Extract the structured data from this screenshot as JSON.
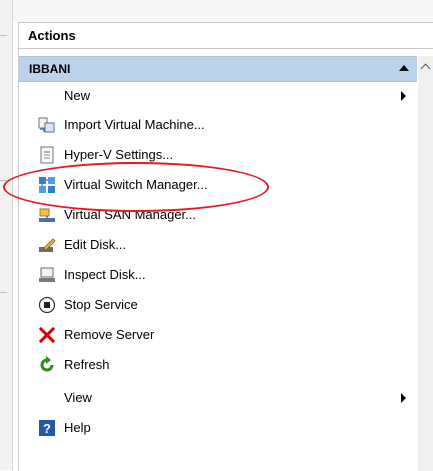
{
  "header": {
    "title": "Actions"
  },
  "group": {
    "label": "IBBANI"
  },
  "items": [
    {
      "label": "New",
      "icon": "none",
      "submenu": true
    },
    {
      "label": "Import Virtual Machine...",
      "icon": "import-vm-icon"
    },
    {
      "label": "Hyper-V Settings...",
      "icon": "settings-document-icon"
    },
    {
      "label": "Virtual Switch Manager...",
      "icon": "virtual-switch-icon"
    },
    {
      "label": "Virtual SAN Manager...",
      "icon": "virtual-san-icon"
    },
    {
      "label": "Edit Disk...",
      "icon": "edit-disk-icon"
    },
    {
      "label": "Inspect Disk...",
      "icon": "inspect-disk-icon"
    },
    {
      "label": "Stop Service",
      "icon": "stop-icon"
    },
    {
      "label": "Remove Server",
      "icon": "remove-icon"
    },
    {
      "label": "Refresh",
      "icon": "refresh-icon"
    },
    {
      "label": "View",
      "icon": "none",
      "submenu": true
    },
    {
      "label": "Help",
      "icon": "help-icon"
    }
  ],
  "colors": {
    "group_bg": "#bcd2e8",
    "annotation": "#e31b23",
    "remove": "#d40000",
    "refresh": "#2e8b1e",
    "help": "#1f5ba8"
  }
}
